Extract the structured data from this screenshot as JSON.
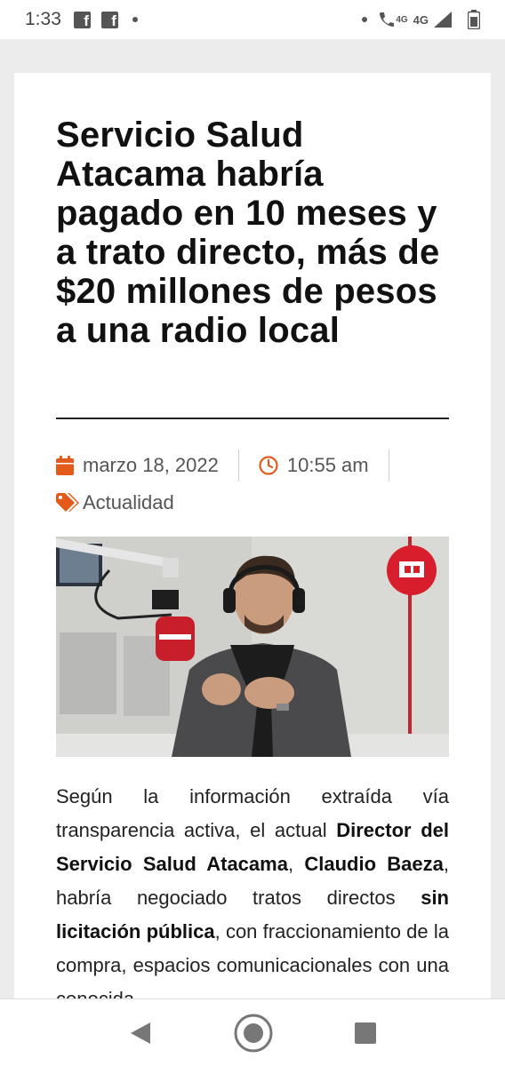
{
  "status_bar": {
    "time": "1:33",
    "network": "4G",
    "network2": "4G"
  },
  "article": {
    "title": "Servicio Salud Atacama habría pagado en 10 meses y a trato directo, más de $20 millones de pesos a una radio local",
    "date": "marzo 18, 2022",
    "time": "10:55 am",
    "category": "Actualidad",
    "body": [
      {
        "text": "Según la información extraída vía transparencia activa, el actual ",
        "bold": false
      },
      {
        "text": "Director del Servicio Salud Atacama",
        "bold": true
      },
      {
        "text": ", ",
        "bold": false
      },
      {
        "text": "Claudio Baeza",
        "bold": true
      },
      {
        "text": ", habría negociado tratos directos ",
        "bold": false
      },
      {
        "text": "sin licitación pública",
        "bold": true
      },
      {
        "text": ", con fraccionamiento de la compra, espacios comunicacionales con una conocida",
        "bold": false
      }
    ]
  },
  "colors": {
    "accent": "#e35b1a",
    "logo_red": "#d81e2c"
  }
}
